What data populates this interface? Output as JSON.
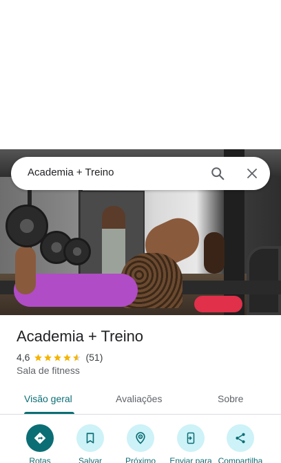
{
  "search": {
    "query": "Academia + Treino",
    "search_icon": "search-icon",
    "close_icon": "close-icon"
  },
  "place": {
    "name": "Academia + Treino",
    "rating": "4,6",
    "rating_value": 4.6,
    "review_count": "(51)",
    "category": "Sala de fitness"
  },
  "tabs": [
    {
      "label": "Visão geral",
      "active": true
    },
    {
      "label": "Avaliações",
      "active": false
    },
    {
      "label": "Sobre",
      "active": false
    }
  ],
  "actions": [
    {
      "label": "Rotas",
      "icon": "directions-icon"
    },
    {
      "label": "Salvar",
      "icon": "bookmark-icon"
    },
    {
      "label": "Próximo",
      "icon": "nearby-icon"
    },
    {
      "label": "Enviar para",
      "icon": "send-to-phone-icon"
    },
    {
      "label": "Compartilha",
      "icon": "share-icon"
    }
  ],
  "colors": {
    "accent": "#0b6e74",
    "action_bg": "#cdf2f7",
    "star": "#f4b400"
  }
}
